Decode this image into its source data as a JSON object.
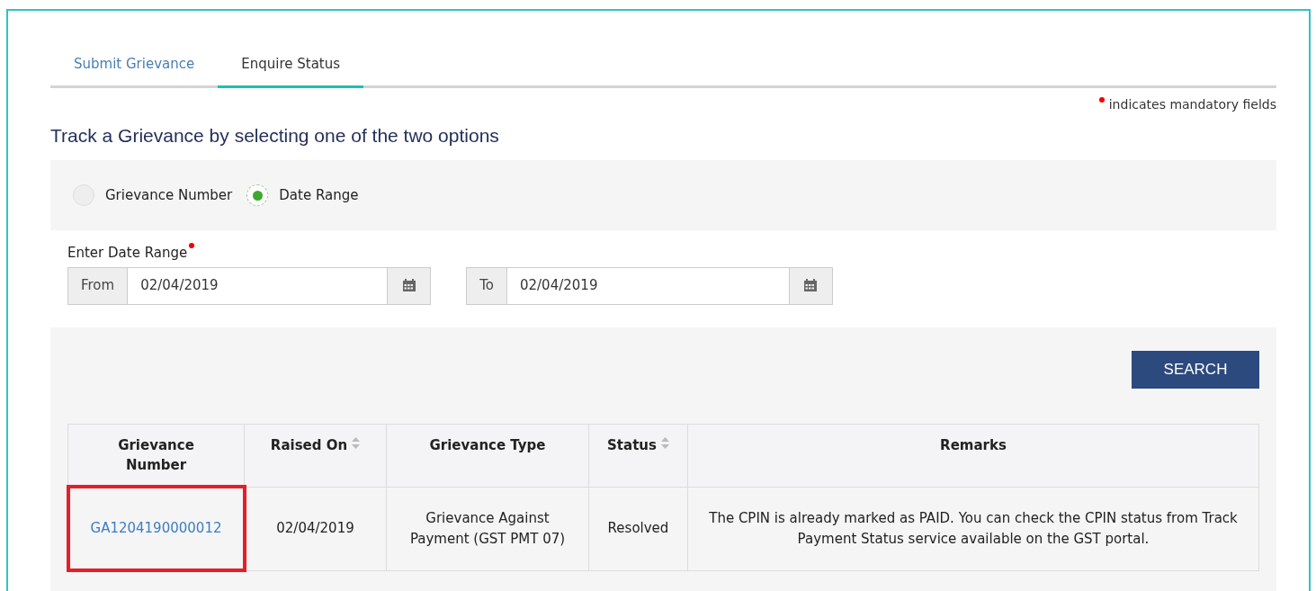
{
  "tabs": [
    {
      "label": "Submit Grievance",
      "selected": false
    },
    {
      "label": "Enquire Status",
      "selected": true
    }
  ],
  "mandatory_note": "indicates mandatory fields",
  "heading": "Track a Grievance by selecting one of the two options",
  "options": [
    {
      "label": "Grievance Number",
      "selected": false
    },
    {
      "label": "Date Range",
      "selected": true
    }
  ],
  "date_range": {
    "label": "Enter Date Range",
    "required": true,
    "from": {
      "prefix": "From",
      "value": "02/04/2019"
    },
    "to": {
      "prefix": "To",
      "value": "02/04/2019"
    }
  },
  "search_button": "SEARCH",
  "table": {
    "columns": [
      {
        "label": "Grievance Number",
        "sortable": false
      },
      {
        "label": "Raised On",
        "sortable": true
      },
      {
        "label": "Grievance Type",
        "sortable": false
      },
      {
        "label": "Status",
        "sortable": true
      },
      {
        "label": "Remarks",
        "sortable": false
      }
    ],
    "rows": [
      {
        "highlighted": true,
        "cells": [
          "GA1204190000012",
          "02/04/2019",
          "Grievance Against Payment (GST PMT 07)",
          "Resolved",
          "The CPIN is already marked as PAID. You can check the CPIN status from Track Payment Status service available on the GST portal."
        ]
      }
    ]
  }
}
